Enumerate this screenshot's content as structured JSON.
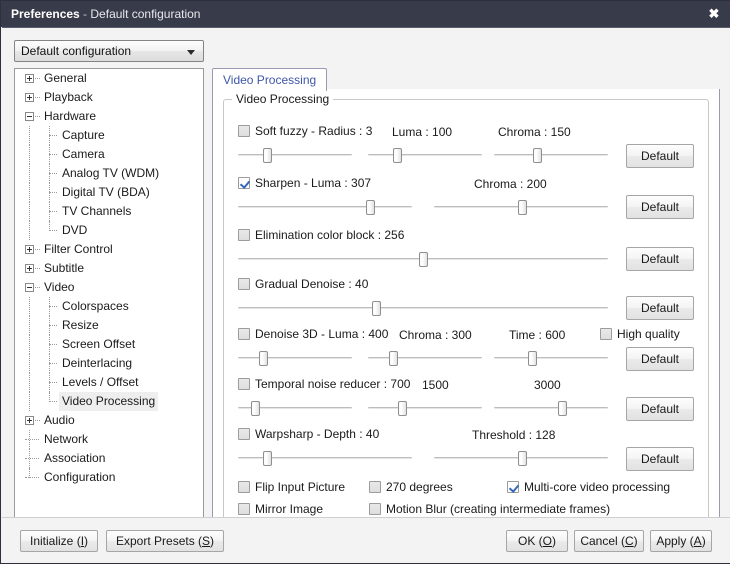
{
  "window": {
    "app_title": "Preferences",
    "separator": " - ",
    "doc_title": "Default configuration",
    "close_icon": "close-icon",
    "close_glyph": "✖"
  },
  "config_combo": {
    "value": "Default configuration",
    "arrow_icon": "chevron-down-icon"
  },
  "tree": {
    "items": [
      {
        "label": "General",
        "depth": 0,
        "expander": "plus",
        "selected": false
      },
      {
        "label": "Playback",
        "depth": 0,
        "expander": "plus",
        "selected": false
      },
      {
        "label": "Hardware",
        "depth": 0,
        "expander": "minus",
        "selected": false
      },
      {
        "label": "Capture",
        "depth": 1,
        "expander": "none",
        "selected": false
      },
      {
        "label": "Camera",
        "depth": 1,
        "expander": "none",
        "selected": false
      },
      {
        "label": "Analog TV (WDM)",
        "depth": 1,
        "expander": "none",
        "selected": false
      },
      {
        "label": "Digital TV (BDA)",
        "depth": 1,
        "expander": "none",
        "selected": false
      },
      {
        "label": "TV Channels",
        "depth": 1,
        "expander": "none",
        "selected": false
      },
      {
        "label": "DVD",
        "depth": 1,
        "expander": "none",
        "selected": false,
        "last": true
      },
      {
        "label": "Filter Control",
        "depth": 0,
        "expander": "plus",
        "selected": false
      },
      {
        "label": "Subtitle",
        "depth": 0,
        "expander": "plus",
        "selected": false
      },
      {
        "label": "Video",
        "depth": 0,
        "expander": "minus",
        "selected": false
      },
      {
        "label": "Colorspaces",
        "depth": 1,
        "expander": "none",
        "selected": false
      },
      {
        "label": "Resize",
        "depth": 1,
        "expander": "none",
        "selected": false
      },
      {
        "label": "Screen Offset",
        "depth": 1,
        "expander": "none",
        "selected": false
      },
      {
        "label": "Deinterlacing",
        "depth": 1,
        "expander": "none",
        "selected": false
      },
      {
        "label": "Levels / Offset",
        "depth": 1,
        "expander": "none",
        "selected": false
      },
      {
        "label": "Video Processing",
        "depth": 1,
        "expander": "none",
        "selected": true,
        "last": true
      },
      {
        "label": "Audio",
        "depth": 0,
        "expander": "plus",
        "selected": false
      },
      {
        "label": "Network",
        "depth": 0,
        "expander": "none",
        "selected": false
      },
      {
        "label": "Association",
        "depth": 0,
        "expander": "none",
        "selected": false
      },
      {
        "label": "Configuration",
        "depth": 0,
        "expander": "none",
        "selected": false,
        "last": true
      }
    ]
  },
  "tab": {
    "label": "Video Processing"
  },
  "group": {
    "title": "Video Processing"
  },
  "rows": {
    "soft_fuzzy": {
      "checkbox_label": "Soft fuzzy - Radius : 3",
      "checked": false,
      "luma_label": "Luma : 100",
      "chroma_label": "Chroma : 150",
      "default_label": "Default"
    },
    "sharpen": {
      "checkbox_label": "Sharpen - Luma : 307",
      "checked": true,
      "chroma_label": "Chroma : 200",
      "default_label": "Default"
    },
    "elimination": {
      "checkbox_label": "Elimination color block : 256",
      "checked": false,
      "default_label": "Default"
    },
    "gradual_denoise": {
      "checkbox_label": "Gradual Denoise : 40",
      "checked": false,
      "default_label": "Default"
    },
    "denoise3d": {
      "checkbox_label": "Denoise 3D  - Luma : 400",
      "checked": false,
      "chroma_label": "Chroma : 300",
      "time_label": "Time : 600",
      "high_quality_label": "High quality",
      "high_quality_checked": false,
      "default_label": "Default"
    },
    "temporal": {
      "checkbox_label": "Temporal noise reducer : 700",
      "checked": false,
      "value2": "1500",
      "value3": "3000",
      "default_label": "Default"
    },
    "warpsharp": {
      "checkbox_label": "Warpsharp - Depth : 40",
      "checked": false,
      "threshold_label": "Threshold : 128",
      "default_label": "Default"
    }
  },
  "flags": [
    {
      "label": "Flip Input Picture",
      "checked": false
    },
    {
      "label": "270 degrees",
      "checked": false
    },
    {
      "label": "Multi-core video processing",
      "checked": true
    },
    {
      "label": "Mirror Image",
      "checked": false
    },
    {
      "label": "Motion Blur (creating intermediate frames)",
      "checked": false
    }
  ],
  "footer": {
    "initialize": {
      "pre": "Initialize (",
      "key": "I",
      "post": ")"
    },
    "export_presets": {
      "pre": "Export Presets (",
      "key": "S",
      "post": ")"
    },
    "ok": {
      "pre": "OK (",
      "key": "O",
      "post": ")"
    },
    "cancel": {
      "pre": "Cancel (",
      "key": "C",
      "post": ")"
    },
    "apply": {
      "pre": "Apply (",
      "key": "A",
      "post": ")"
    }
  }
}
